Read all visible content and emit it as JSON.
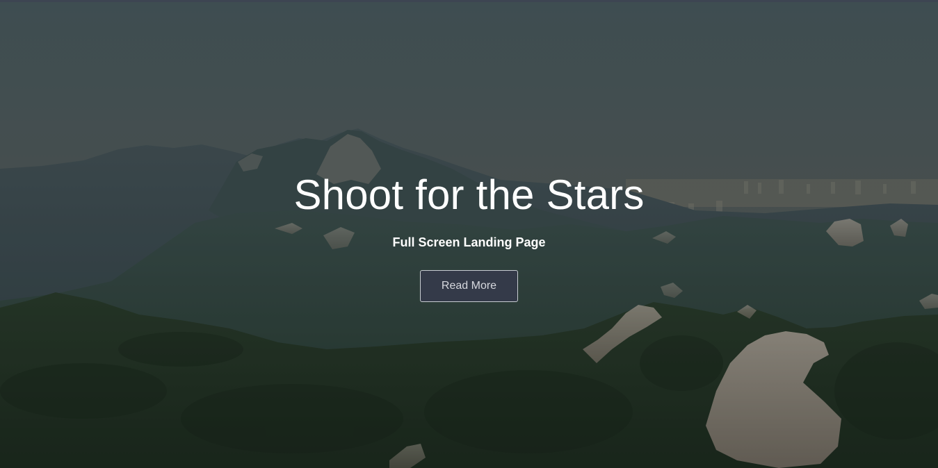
{
  "hero": {
    "title": "Shoot for the Stars",
    "subtitle": "Full Screen Landing Page",
    "button_label": "Read More"
  },
  "colors": {
    "sky_top": "#4e6064",
    "sky_haze": "#6d6a5e",
    "mountain_far": "#3a4c52",
    "forest_dark": "#1f3020",
    "rock": "#b8a99a",
    "button_bg": "#363a4c",
    "text": "#ffffff"
  }
}
